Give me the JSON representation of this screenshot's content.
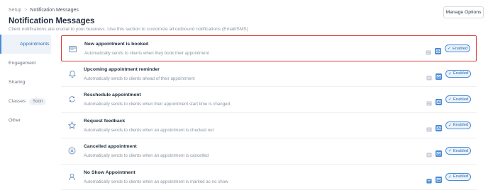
{
  "breadcrumb": {
    "root": "Setup",
    "separator": ">",
    "current": "Notification Messages"
  },
  "page": {
    "title": "Notification Messages",
    "subtitle": "Client notifications are crucial to your business. Use this section to customize all outbound notifications (Email/SMS)"
  },
  "header": {
    "manage_label": "Manage Options"
  },
  "sidebar": {
    "items": [
      {
        "label": "Appointments",
        "active": true
      },
      {
        "label": "Engagement"
      },
      {
        "label": "Sharing"
      },
      {
        "label": "Classes",
        "badge": "Soon"
      },
      {
        "label": "Other"
      }
    ]
  },
  "notifications": [
    {
      "title": "New appointment is booked",
      "description": "Automatically sends to clients when they book their appointment",
      "status": "Enabled",
      "icon": "calendar-icon"
    },
    {
      "title": "Upcoming appointment reminder",
      "description": "Automatically sends to clients ahead of their appointment",
      "status": "Enabled",
      "icon": "bell-icon"
    },
    {
      "title": "Reschedule appointment",
      "description": "Automatically sends to clients when their appointment start time is changed",
      "status": "Enabled",
      "icon": "refresh-icon"
    },
    {
      "title": "Request feedback",
      "description": "Automatically sends to clients when an appointment is checked out",
      "status": "Enabled",
      "icon": "star-icon"
    },
    {
      "title": "Cancelled appointment",
      "description": "Automatically sends to clients when an appointment is cancelled",
      "status": "Enabled",
      "icon": "cancel-icon"
    },
    {
      "title": "No Show Appointment",
      "description": "Automatically sends to clients when an appointment is marked as no show",
      "status": "Enabled",
      "icon": "user-icon"
    }
  ],
  "colors": {
    "accent": "#4a8bd4",
    "highlight": "#d93a35"
  }
}
